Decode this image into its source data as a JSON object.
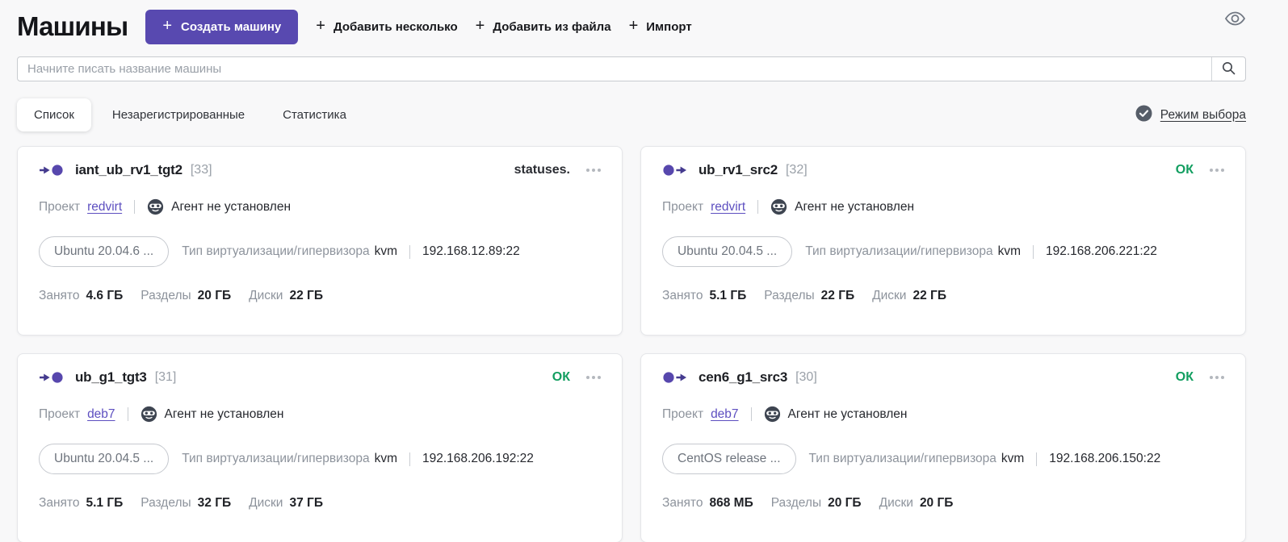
{
  "header": {
    "title": "Машины",
    "create_button": "Создать машину",
    "add_multiple_button": "Добавить несколько",
    "add_from_file_button": "Добавить из файла",
    "import_button": "Импорт"
  },
  "search": {
    "placeholder": "Начните писать название машины"
  },
  "tabs": [
    {
      "label": "Список",
      "active": true
    },
    {
      "label": "Незарегистрированные",
      "active": false
    },
    {
      "label": "Статистика",
      "active": false
    }
  ],
  "selection_mode_label": "Режим выбора",
  "field_labels": {
    "project": "Проект",
    "virt_type": "Тип виртуализации/гипервизора",
    "used": "Занято",
    "partitions": "Разделы",
    "disks": "Диски"
  },
  "colors": {
    "accent_purple": "#5849b0",
    "link_purple": "#5d4fc0",
    "status_ok_green": "#129e60",
    "status_dark": "#2b2d33",
    "icon_circle_purple": "#5747ad",
    "icon_arrow_purple": "#453b8f"
  },
  "cards": [
    {
      "name": "iant_ub_rv1_tgt2",
      "id_badge": "[33]",
      "direction": "target",
      "status": "statuses.",
      "status_color": "#2b2d33",
      "project": "redvirt",
      "agent_status": "Агент не установлен",
      "os": "Ubuntu 20.04.6 ...",
      "virt": "kvm",
      "address": "192.168.12.89:22",
      "used": "4.6 ГБ",
      "partitions": "20 ГБ",
      "disks": "22 ГБ"
    },
    {
      "name": "ub_rv1_src2",
      "id_badge": "[32]",
      "direction": "source",
      "status": "ОК",
      "status_color": "#129e60",
      "project": "redvirt",
      "agent_status": "Агент не установлен",
      "os": "Ubuntu 20.04.5 ...",
      "virt": "kvm",
      "address": "192.168.206.221:22",
      "used": "5.1 ГБ",
      "partitions": "22 ГБ",
      "disks": "22 ГБ"
    },
    {
      "name": "ub_g1_tgt3",
      "id_badge": "[31]",
      "direction": "target",
      "status": "ОК",
      "status_color": "#129e60",
      "project": "deb7",
      "agent_status": "Агент не установлен",
      "os": "Ubuntu 20.04.5 ...",
      "virt": "kvm",
      "address": "192.168.206.192:22",
      "used": "5.1 ГБ",
      "partitions": "32 ГБ",
      "disks": "37 ГБ"
    },
    {
      "name": "cen6_g1_src3",
      "id_badge": "[30]",
      "direction": "source",
      "status": "ОК",
      "status_color": "#129e60",
      "project": "deb7",
      "agent_status": "Агент не установлен",
      "os": "CentOS release ...",
      "virt": "kvm",
      "address": "192.168.206.150:22",
      "used": "868 МБ",
      "partitions": "20 ГБ",
      "disks": "20 ГБ"
    }
  ]
}
